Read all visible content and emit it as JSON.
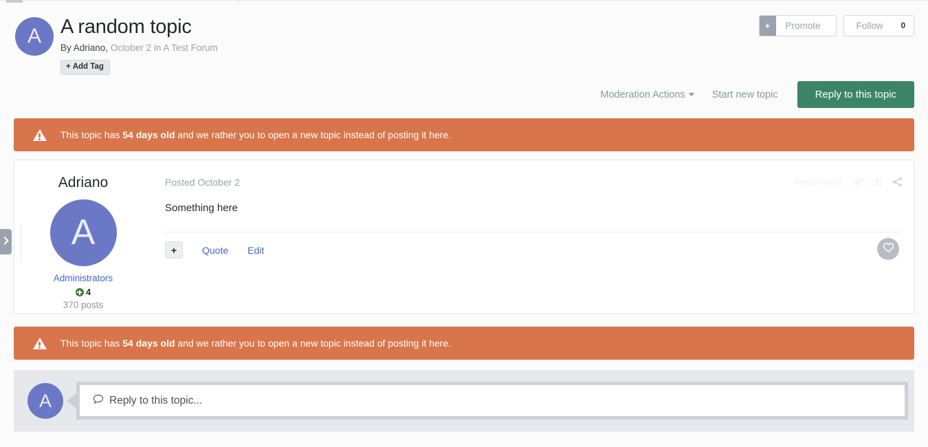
{
  "topic": {
    "title": "A random topic",
    "by_prefix": "By Adriano,",
    "date_forum": "October 2 in A Test Forum",
    "avatar_initial": "A",
    "add_tag_label": "Add Tag",
    "add_tag_icon": "plus-icon"
  },
  "header_buttons": {
    "promote_label": "Promote",
    "promote_icon": "plus-icon",
    "follow_label": "Follow",
    "follow_count": "0"
  },
  "action_bar": {
    "moderation_label": "Moderation Actions",
    "moderation_caret": "chevron-down-icon",
    "start_new_label": "Start new topic",
    "reply_label": "Reply to this topic"
  },
  "warning": {
    "icon": "warning-triangle-icon",
    "text_before": "This topic has ",
    "text_bold": "54 days old",
    "text_after": " and we rather you to open a new topic instead of posting it here."
  },
  "post": {
    "username": "Adriano",
    "avatar_initial": "A",
    "group": "Administrators",
    "reputation": "4",
    "reputation_icon": "reputation-plus-icon",
    "post_count": "370 posts",
    "posted_date": "Posted October 2",
    "report_label": "Report post",
    "ip_label": "(IP: ::1)",
    "share_icon": "share-icon",
    "body": "Something here",
    "tool_plus_icon": "plus-icon",
    "quote_label": "Quote",
    "edit_label": "Edit",
    "like_icon": "heart-icon"
  },
  "reply_box": {
    "avatar_initial": "A",
    "placeholder": "Reply to this topic...",
    "placeholder_icon": "comment-bubble-icon"
  },
  "sidebar_toggle": {
    "icon": "chevron-right-icon"
  },
  "colors": {
    "avatar_blue": "#6a78c5",
    "warning_orange": "#d9754a",
    "reply_green": "#3c8468",
    "link_blue": "#3f68c4",
    "muted_gray": "#9aa2ad",
    "page_bg": "#fbfbfc"
  }
}
